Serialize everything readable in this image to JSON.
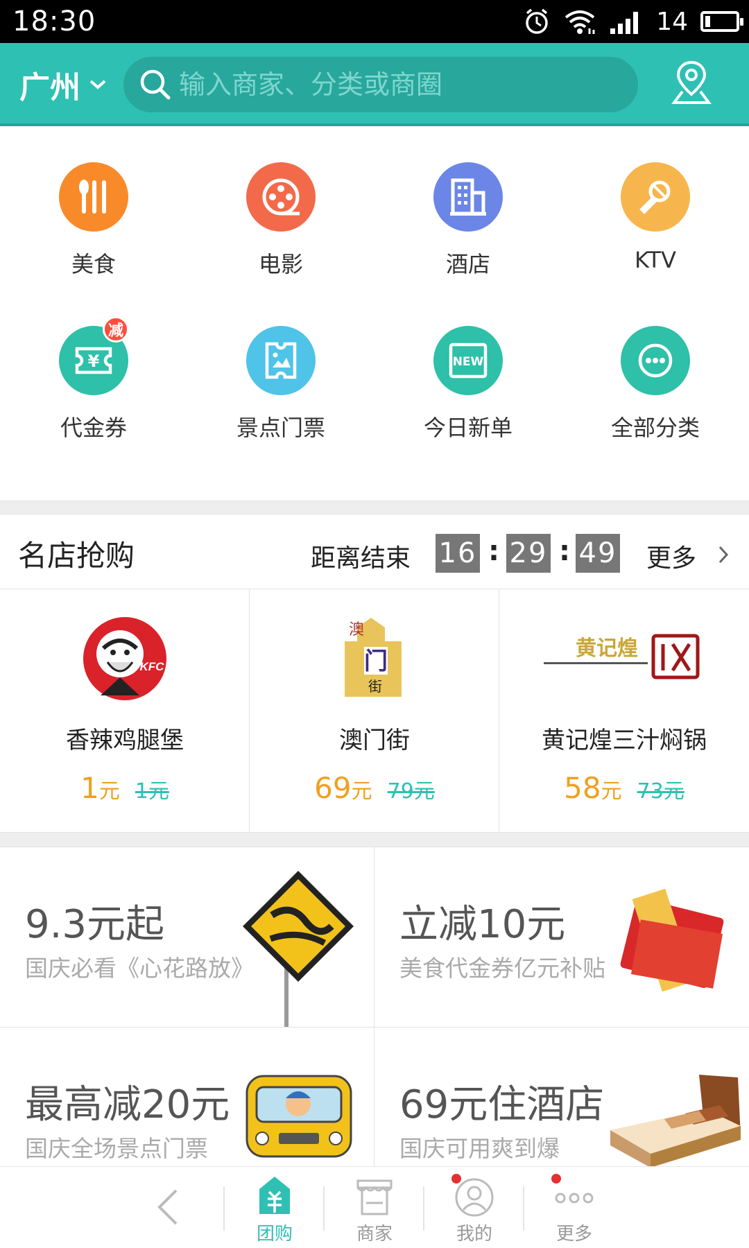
{
  "status_bar": {
    "time": "18:30",
    "battery": "14",
    "battery_level": 0.14
  },
  "header": {
    "city": "广州",
    "search_placeholder": "输入商家、分类或商圈",
    "icons": [
      "chevron-down-icon",
      "search-icon",
      "location-icon"
    ]
  },
  "categories": [
    {
      "label": "美食",
      "icon": "utensils-icon",
      "color": "#f98a2a"
    },
    {
      "label": "电影",
      "icon": "film-reel-icon",
      "color": "#f26a4a"
    },
    {
      "label": "酒店",
      "icon": "building-icon",
      "color": "#6b86e6"
    },
    {
      "label": "KTV",
      "icon": "microphone-icon",
      "color": "#f6b64d"
    },
    {
      "label": "代金券",
      "icon": "voucher-icon",
      "color": "#2ec0a8",
      "badge": "减"
    },
    {
      "label": "景点门票",
      "icon": "ticket-icon",
      "color": "#4fc3e8"
    },
    {
      "label": "今日新单",
      "icon": "new-icon",
      "color": "#2ec0a8",
      "icon_text": "NEW"
    },
    {
      "label": "全部分类",
      "icon": "more-dots-icon",
      "color": "#2ec0a8"
    }
  ],
  "flash_sale": {
    "title": "名店抢购",
    "countdown_label": "距离结束",
    "hours": "16",
    "minutes": "29",
    "seconds": "49",
    "more": "更多",
    "deals": [
      {
        "name": "香辣鸡腿堡",
        "price": "1",
        "unit": "元",
        "original": "1元",
        "logo": "kfc-logo"
      },
      {
        "name": "澳门街",
        "price": "69",
        "unit": "元",
        "original": "79元",
        "logo": "aomenjie-logo",
        "logo_text": [
          "澳",
          "门",
          "街"
        ]
      },
      {
        "name": "黄记煌三汁焖锅",
        "price": "58",
        "unit": "元",
        "original": "73元",
        "logo": "huangjihuang-logo",
        "logo_text": "黄记煌"
      }
    ]
  },
  "promos": [
    {
      "title": "9.3元起",
      "subtitle": "国庆必看《心花路放》",
      "art": "movie-sign-art"
    },
    {
      "title": "立减10元",
      "subtitle": "美食代金券亿元补贴",
      "art": "red-envelope-art"
    },
    {
      "title": "最高减20元",
      "subtitle": "国庆全场景点门票",
      "art": "bus-art"
    },
    {
      "title": "69元住酒店",
      "subtitle": "国庆可用爽到爆",
      "art": "bed-art"
    }
  ],
  "bottom_nav": {
    "items": [
      {
        "label": "团购",
        "icon": "tuangou-icon",
        "active": true
      },
      {
        "label": "商家",
        "icon": "store-icon",
        "active": false
      },
      {
        "label": "我的",
        "icon": "user-icon",
        "active": false,
        "dot": true
      },
      {
        "label": "更多",
        "icon": "more-icon",
        "active": false,
        "dot": true
      }
    ]
  },
  "colors": {
    "primary": "#2ec0b3",
    "price": "#f0a020",
    "countdown_bg": "#777777"
  }
}
